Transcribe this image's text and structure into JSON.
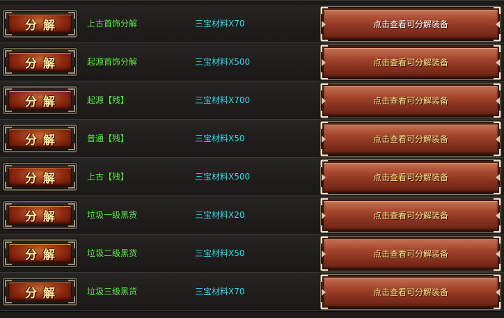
{
  "decompose_label": "分解",
  "view_label": "点击查看可分解装备",
  "colors": {
    "item_name": "#5fe24a",
    "reward": "#3ad2e8",
    "button_text": "#f6e58a"
  },
  "rows": [
    {
      "name": "上古首饰分解",
      "reward": "三宝材料X70"
    },
    {
      "name": "起源首饰分解",
      "reward": "三宝材料X500"
    },
    {
      "name": "起源【残】",
      "reward": "三宝材料X700"
    },
    {
      "name": "普通【残】",
      "reward": "三宝材料X50"
    },
    {
      "name": "上古【残】",
      "reward": "三宝材料X500"
    },
    {
      "name": "垃圾一级黑货",
      "reward": "三宝材料X20"
    },
    {
      "name": "垃圾二级黑货",
      "reward": "三宝材料X50"
    },
    {
      "name": "垃圾三级黑货",
      "reward": "三宝材料X70"
    }
  ]
}
